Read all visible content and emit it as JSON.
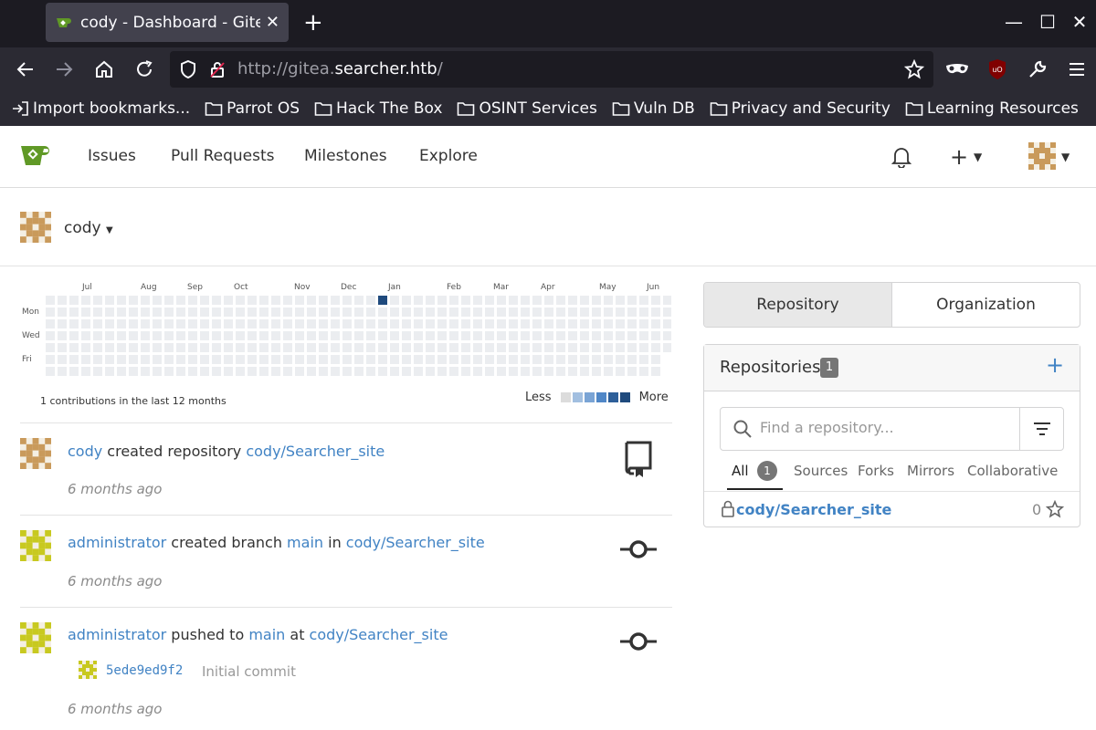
{
  "browser": {
    "tab_title": "cody - Dashboard - Gitea: Git with a cup of tea",
    "url_prefix": "http://gitea.",
    "url_host": "searcher.htb",
    "url_suffix": "/",
    "bookmarks": [
      {
        "label": "Import bookmarks...",
        "icon": "import-icon"
      },
      {
        "label": "Parrot OS",
        "icon": "folder-icon"
      },
      {
        "label": "Hack The Box",
        "icon": "folder-icon"
      },
      {
        "label": "OSINT Services",
        "icon": "folder-icon"
      },
      {
        "label": "Vuln DB",
        "icon": "folder-icon"
      },
      {
        "label": "Privacy and Security",
        "icon": "folder-icon"
      },
      {
        "label": "Learning Resources",
        "icon": "folder-icon"
      }
    ]
  },
  "gitea": {
    "nav": [
      "Issues",
      "Pull Requests",
      "Milestones",
      "Explore"
    ],
    "user": "cody",
    "heatmap": {
      "months": [
        "Jul",
        "Aug",
        "Sep",
        "Oct",
        "Nov",
        "Dec",
        "Jan",
        "Feb",
        "Mar",
        "Apr",
        "May",
        "Jun"
      ],
      "days": [
        "Mon",
        "Wed",
        "Fri"
      ],
      "summary": "1 contributions in the last 12 months",
      "legend_less": "Less",
      "legend_more": "More",
      "legend_colors": [
        "#dcdcdc",
        "#a2bfe0",
        "#7aa4d5",
        "#5087c7",
        "#2e5f99",
        "#1f4a7d"
      ],
      "active_week": 28,
      "active_day": 0
    },
    "feed": [
      {
        "actor": "cody",
        "action": " created repository ",
        "target": "cody/Searcher_site",
        "time": "6 months ago"
      },
      {
        "actor": "administrator",
        "action": " created branch ",
        "branch": "main",
        "mid": " in ",
        "target": "cody/Searcher_site",
        "time": "6 months ago"
      },
      {
        "actor": "administrator",
        "action": " pushed to ",
        "branch": "main",
        "mid": " at ",
        "target": "cody/Searcher_site",
        "commit_hash": "5ede9ed9f2",
        "commit_msg": "Initial commit",
        "time": "6 months ago"
      }
    ],
    "panel": {
      "tabs": [
        "Repository",
        "Organization"
      ],
      "repos_title": "Repositories",
      "repos_count": "1",
      "search_placeholder": "Find a repository...",
      "filters": [
        "All",
        "Sources",
        "Forks",
        "Mirrors",
        "Collaborative"
      ],
      "all_count": "1",
      "repo_name": "cody/Searcher_site",
      "repo_stars": "0"
    }
  }
}
